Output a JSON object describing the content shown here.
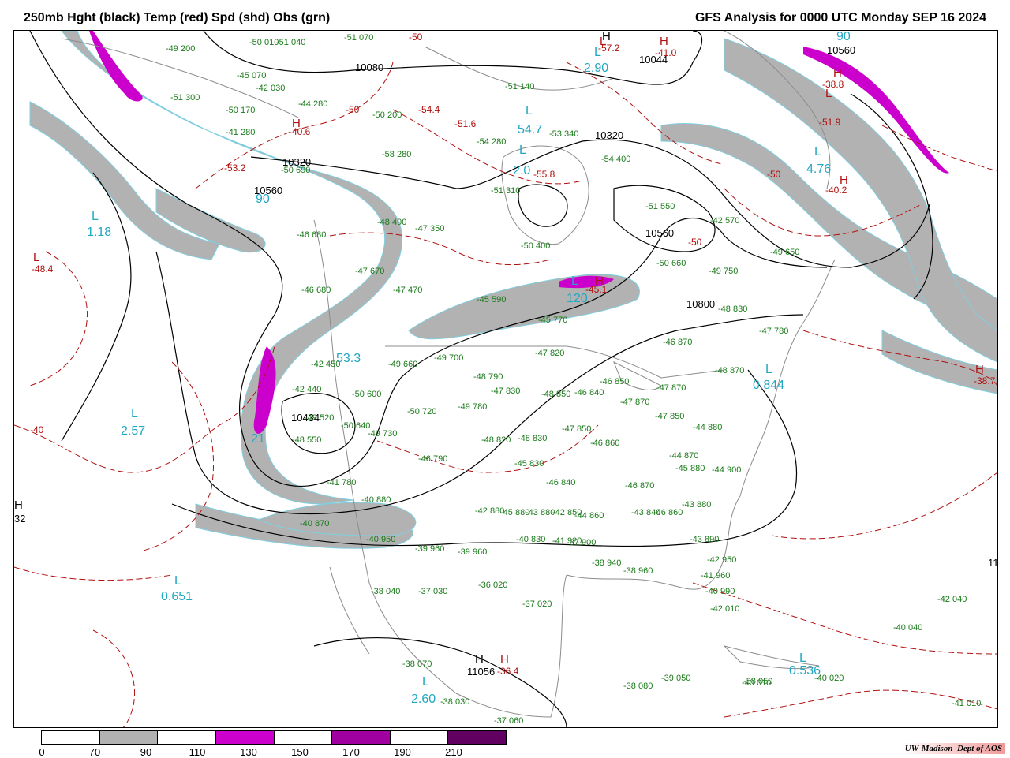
{
  "header": {
    "left_title": "250mb Hght (black) Temp (red) Spd (shd) Obs (grn)",
    "right_title": "GFS Analysis for 0000 UTC Monday  SEP 16 2024"
  },
  "colors": {
    "speed_70_90": "#b2b2b2",
    "speed_110_130": "#cc00cc",
    "speed_150_170": "#a000a0",
    "speed_190_210": "#620062",
    "height_contour": "#000000",
    "temp_contour": "#b01010",
    "obs": "#1a7a1a",
    "isotach_label": "#22a7c2"
  },
  "legend": {
    "ticks": [
      "0",
      "70",
      "90",
      "110",
      "130",
      "150",
      "170",
      "190",
      "210"
    ],
    "segment_colors": [
      "#ffffff",
      "#b2b2b2",
      "#ffffff",
      "#cc00cc",
      "#ffffff",
      "#a000a0",
      "#ffffff",
      "#620062"
    ]
  },
  "height_labels": [
    "10080",
    "10320",
    "10560",
    "10560",
    "10800",
    "10434",
    "10320",
    "11056",
    "10044",
    "10560"
  ],
  "pressure_centers": {
    "highs": [
      "H",
      "H",
      "H",
      "H",
      "H",
      "H",
      "H",
      "H",
      "H",
      "H"
    ],
    "lows": [
      "L",
      "L",
      "L",
      "L",
      "L",
      "L",
      "L",
      "L",
      "L",
      "L",
      "L",
      "L",
      "L",
      "L"
    ]
  },
  "cyan_values": [
    "2.90",
    "54.7",
    "2.0",
    "4.76",
    "1.18",
    "120",
    "0.844",
    "2.57",
    "0.651",
    "0.536",
    "2.60",
    "90",
    "90",
    "21",
    "53.3"
  ],
  "red_values": [
    "-57.2",
    "-41.0",
    "-38.8",
    "-51.9",
    "-54.4",
    "-51.6",
    "-40.2",
    "-53.2",
    "-40.6",
    "-48.4",
    "-50",
    "-45.1",
    "-55.8",
    "-38.7",
    "-40",
    "-36.4",
    "-50",
    "-50",
    "-50"
  ],
  "edge_labels": [
    "H",
    "32",
    "11"
  ],
  "obs": [
    "-51 070",
    "-50 010",
    "-51 040",
    "-49 200",
    "-45 070",
    "-51 300",
    "-42 030",
    "-44 280",
    "-50 170",
    "-41 280",
    "-50 200",
    "-51 140",
    "-54 280",
    "-58 280",
    "-53 340",
    "-50 690",
    "-54 400",
    "-51 310",
    "-48 490",
    "-47 350",
    "-46 680",
    "-51 550",
    "-42 570",
    "-50 400",
    "-49 650",
    "-50 660",
    "-47 470",
    "-47 670",
    "-46 680",
    "-45 590",
    "-45 770",
    "-48 830",
    "-49 750",
    "-47 780",
    "-42 450",
    "-46 870",
    "-49 660",
    "-49 700",
    "-47 820",
    "-48 870",
    "-42 440",
    "-50 600",
    "-48 790",
    "-47 830",
    "-48 850",
    "-46 840",
    "-46 850",
    "-47 870",
    "-47 870",
    "-50 720",
    "-49 780",
    "-49 520",
    "-50 640",
    "-49 730",
    "-47 850",
    "-48 820",
    "-48 830",
    "-46 860",
    "-47 850",
    "-44 880",
    "-46 790",
    "-45 830",
    "-46 840",
    "-46 870",
    "-44 870",
    "-44 900",
    "-45 880",
    "-41 780",
    "-43 840",
    "-46 860",
    "-42 880",
    "-45 880",
    "-43 880",
    "-42 850",
    "-44 860",
    "-43 880",
    "-43 890",
    "-40 870",
    "-40 950",
    "-39 960",
    "-39 960",
    "-40 830",
    "-41 920",
    "-37 900",
    "-38 940",
    "-38 960",
    "-42 950",
    "-41 960",
    "-40 990",
    "-42 010",
    "-38 040",
    "-37 030",
    "-36 020",
    "-37 020",
    "-42 040",
    "-40 040",
    "-38 070",
    "-38 030",
    "-38 080",
    "-39 050",
    "-40 010",
    "-40 020",
    "-38 050",
    "-37 060",
    "-41 010",
    "-40 880",
    "-48 550"
  ]
}
